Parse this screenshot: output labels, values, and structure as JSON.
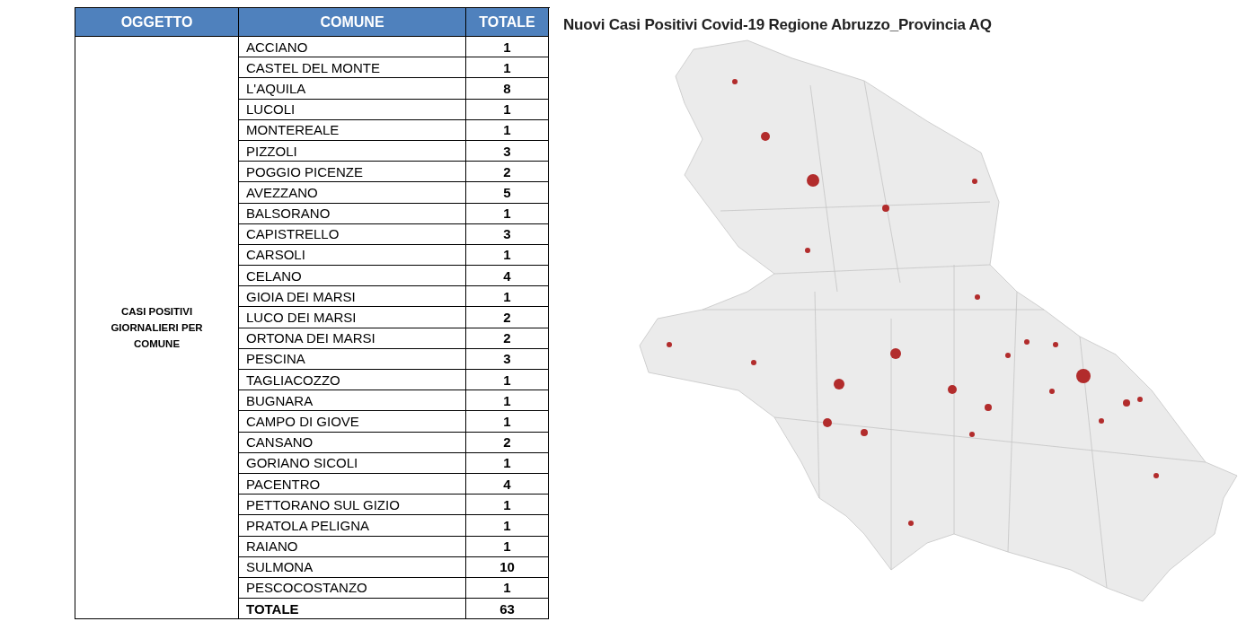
{
  "table": {
    "columns": [
      "OGGETTO",
      "COMUNE",
      "TOTALE"
    ],
    "subject": "CASI POSITIVI GIORNALIERI PER COMUNE",
    "rows": [
      {
        "comune": "ACCIANO",
        "totale": "1"
      },
      {
        "comune": "CASTEL DEL MONTE",
        "totale": "1"
      },
      {
        "comune": "L'AQUILA",
        "totale": "8"
      },
      {
        "comune": "LUCOLI",
        "totale": "1"
      },
      {
        "comune": "MONTEREALE",
        "totale": "1"
      },
      {
        "comune": "PIZZOLI",
        "totale": "3"
      },
      {
        "comune": "POGGIO PICENZE",
        "totale": "2"
      },
      {
        "comune": "AVEZZANO",
        "totale": "5"
      },
      {
        "comune": "BALSORANO",
        "totale": "1"
      },
      {
        "comune": "CAPISTRELLO",
        "totale": "3"
      },
      {
        "comune": "CARSOLI",
        "totale": "1"
      },
      {
        "comune": "CELANO",
        "totale": "4"
      },
      {
        "comune": "GIOIA DEI MARSI",
        "totale": "1"
      },
      {
        "comune": "LUCO DEI MARSI",
        "totale": "2"
      },
      {
        "comune": "ORTONA DEI MARSI",
        "totale": "2"
      },
      {
        "comune": "PESCINA",
        "totale": "3"
      },
      {
        "comune": "TAGLIACOZZO",
        "totale": "1"
      },
      {
        "comune": "BUGNARA",
        "totale": "1"
      },
      {
        "comune": "CAMPO DI GIOVE",
        "totale": "1"
      },
      {
        "comune": "CANSANO",
        "totale": "2"
      },
      {
        "comune": "GORIANO SICOLI",
        "totale": "1"
      },
      {
        "comune": "PACENTRO",
        "totale": "4"
      },
      {
        "comune": "PETTORANO SUL GIZIO",
        "totale": "1"
      },
      {
        "comune": "PRATOLA PELIGNA",
        "totale": "1"
      },
      {
        "comune": "RAIANO",
        "totale": "1"
      },
      {
        "comune": "SULMONA",
        "totale": "10"
      },
      {
        "comune": "PESCOCOSTANZO",
        "totale": "1"
      }
    ],
    "total": {
      "label": "TOTALE",
      "value": "63"
    }
  },
  "map": {
    "title": "Nuovi Casi Positivi Covid-19 Regione Abruzzo_Provincia AQ"
  }
}
